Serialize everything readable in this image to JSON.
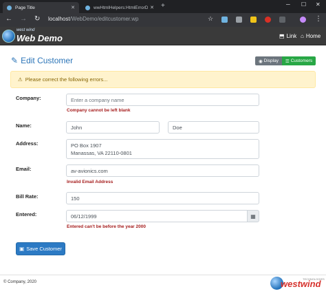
{
  "browser": {
    "tabs": [
      {
        "label": "Page Title",
        "active": true
      },
      {
        "label": "wwHtmlHelpers:HtmlErrorDisplay",
        "active": false
      }
    ],
    "url_host": "localhost",
    "url_path": "/WebDemo/editcustomer.wp"
  },
  "navbar": {
    "logo_small": "west wind",
    "logo_title": "Web Demo",
    "link_label": "Link",
    "home_label": "Home"
  },
  "page": {
    "title": "Edit Customer",
    "display_label": "Display",
    "customers_label": "Customers",
    "alert": "Please correct the following errors..."
  },
  "form": {
    "company_label": "Company:",
    "company_placeholder": "Enter a company name",
    "company_error": "Company cannot be left blank",
    "name_label": "Name:",
    "first_name": "John",
    "last_name": "Doe",
    "address_label": "Address:",
    "address_line1": "PO Box 1907",
    "address_line2": "Manassas, VA 22110-0801",
    "email_label": "Email:",
    "email_value": "av-avionics.com",
    "email_error": "Invalid Email Address",
    "billrate_label": "Bill Rate:",
    "billrate_value": "150",
    "entered_label": "Entered:",
    "entered_value": "06/12/1999",
    "entered_error": "Entered can't be before the year 2000",
    "save_label": "Save Customer"
  },
  "footer": {
    "copyright": "© Company, 2020",
    "logo_text": "westwind",
    "logo_tag": "TECHNOLOGIES"
  },
  "colors": {
    "accent": "#2c75b8",
    "success": "#28a745",
    "error": "#a51c1c",
    "warning_bg": "#fff3cd"
  }
}
